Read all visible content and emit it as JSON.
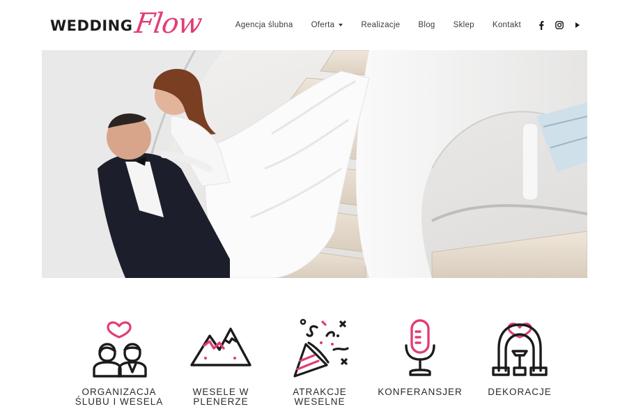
{
  "brand": {
    "wordmark": "WEDDING",
    "script": "Flow",
    "accent_color": "#e23d74"
  },
  "nav": {
    "items": [
      {
        "label": "Agencja ślubna"
      },
      {
        "label": "Oferta",
        "has_dropdown": true
      },
      {
        "label": "Realizacje"
      },
      {
        "label": "Blog"
      },
      {
        "label": "Sklep"
      },
      {
        "label": "Kontakt"
      }
    ],
    "social": [
      "facebook-icon",
      "instagram-icon",
      "play-icon"
    ]
  },
  "hero": {
    "image": "wedding-couple-on-spiral-staircase"
  },
  "services": [
    {
      "label": "ORGANIZACJA\nŚLUBU I WESELA",
      "icon": "couple-heart-icon"
    },
    {
      "label": "WESELE W\nPLENERZE",
      "icon": "mountains-icon"
    },
    {
      "label": "ATRAKCJE\nWESELNE",
      "icon": "party-popper-icon"
    },
    {
      "label": "KONFERANSJER",
      "icon": "microphone-icon"
    },
    {
      "label": "DEKORACJE",
      "icon": "wedding-arch-icon"
    }
  ]
}
